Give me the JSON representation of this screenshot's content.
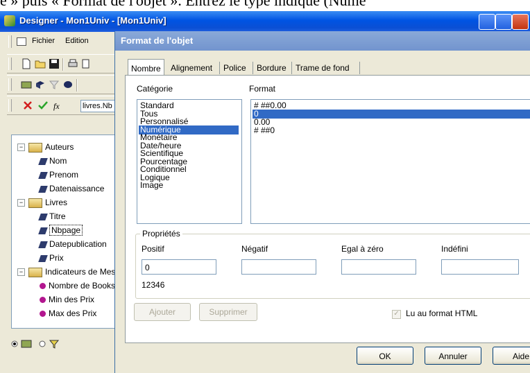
{
  "caption": "e » puis « Format de l'objet ». Entrez le type indiqué (Numé",
  "window": {
    "title": "Designer - Mon1Univ - [Mon1Univ]"
  },
  "menubar": {
    "items": [
      "Fichier",
      "Edition"
    ]
  },
  "formula": {
    "value": "livres.Nb"
  },
  "tree": {
    "nodes": [
      {
        "label": "Auteurs",
        "kind": "folder",
        "level": 0
      },
      {
        "label": "Nom",
        "kind": "field",
        "level": 1
      },
      {
        "label": "Prenom",
        "kind": "field",
        "level": 1
      },
      {
        "label": "Datenaissance",
        "kind": "field",
        "level": 1
      },
      {
        "label": "Livres",
        "kind": "folder",
        "level": 0
      },
      {
        "label": "Titre",
        "kind": "field",
        "level": 1
      },
      {
        "label": "Nbpage",
        "kind": "field",
        "level": 1,
        "selected": true
      },
      {
        "label": "Datepublication",
        "kind": "field",
        "level": 1
      },
      {
        "label": "Prix",
        "kind": "field",
        "level": 1
      },
      {
        "label": "Indicateurs de Mesure",
        "kind": "folder",
        "level": 0
      },
      {
        "label": "Nombre de Books",
        "kind": "measure",
        "level": 1
      },
      {
        "label": "Min des Prix",
        "kind": "measure",
        "level": 1
      },
      {
        "label": "Max des Prix",
        "kind": "measure",
        "level": 1
      }
    ]
  },
  "dialog": {
    "title": "Format de l'objet",
    "tabs": [
      "Nombre",
      "Alignement",
      "Police",
      "Bordure",
      "Trame de fond"
    ],
    "active_tab": "Nombre",
    "categorie_label": "Catégorie",
    "format_label": "Format",
    "categories": [
      "Standard",
      "Tous",
      "Personnalisé",
      "Numérique",
      "Monétaire",
      "Date/heure",
      "Scientifique",
      "Pourcentage",
      "Conditionnel",
      "Logique",
      "Image"
    ],
    "selected_category": "Numérique",
    "formats": [
      "# ##0.00",
      "0",
      "0.00",
      "# ##0"
    ],
    "selected_format": "0",
    "proprietes": {
      "title": "Propriétés",
      "positif_label": "Positif",
      "negatif_label": "Négatif",
      "zero_label": "Egal à zéro",
      "indefini_label": "Indéfini",
      "positif_value": "0",
      "negatif_value": "",
      "zero_value": "",
      "indefini_value": "",
      "preview": "12346"
    },
    "ajouter_label": "Ajouter",
    "supprimer_label": "Supprimer",
    "html_label": "Lu au format HTML",
    "html_checked": true,
    "ok_label": "OK",
    "annuler_label": "Annuler",
    "aide_label": "Aide"
  }
}
